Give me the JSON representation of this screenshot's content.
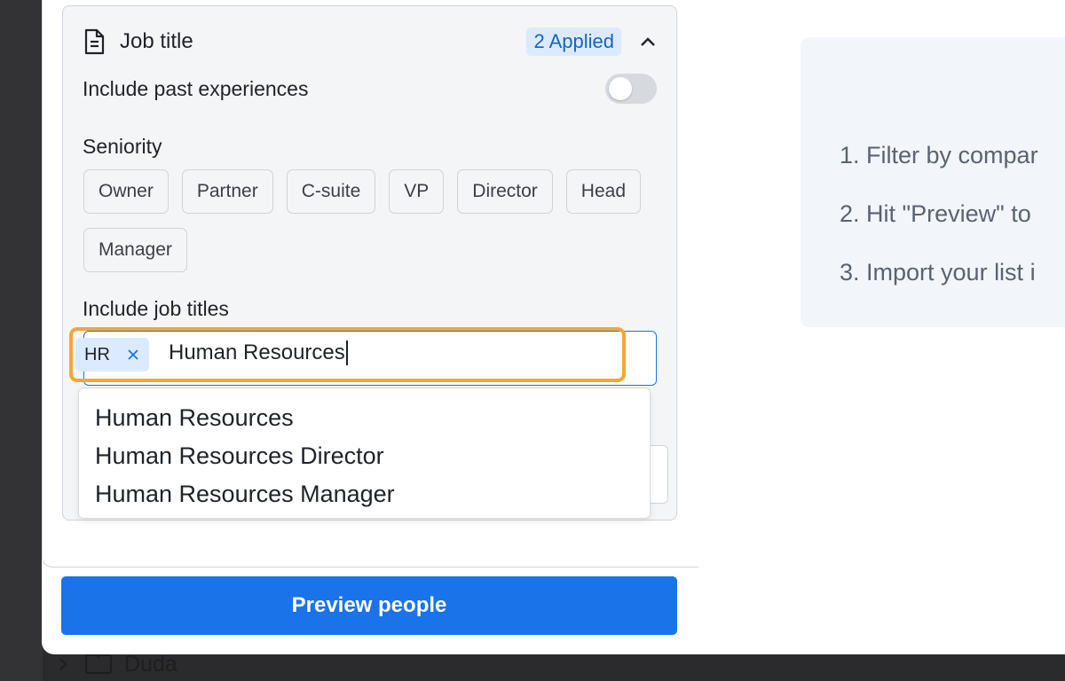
{
  "background": {
    "folder_row": {
      "label": "Duda"
    }
  },
  "filter_card": {
    "title": "Job title",
    "applied_badge": "2 Applied",
    "past_experiences": {
      "label": "Include past experiences",
      "enabled": false
    },
    "seniority": {
      "label": "Seniority",
      "options": [
        "Owner",
        "Partner",
        "C-suite",
        "VP",
        "Director",
        "Head",
        "Manager"
      ]
    },
    "job_titles": {
      "label": "Include job titles",
      "tags": [
        "HR"
      ],
      "input_value": "Human Resources",
      "suggestions": [
        "Human Resources",
        "Human Resources Director",
        "Human Resources Manager"
      ]
    }
  },
  "preview_button": "Preview people",
  "info_panel": {
    "steps": [
      "1. Filter by compar",
      "2. Hit \"Preview\" to",
      "3. Import your list i"
    ]
  },
  "colors": {
    "accent": "#1a73e8",
    "badge_bg": "#dceaff",
    "badge_text": "#1565c0",
    "highlight": "#f4a63a"
  }
}
